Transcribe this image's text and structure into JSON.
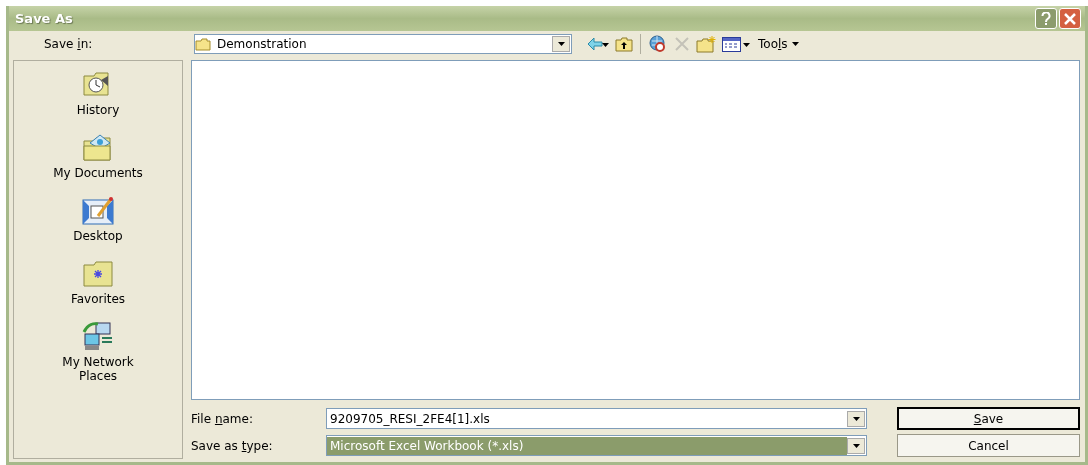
{
  "window": {
    "title": "Save As"
  },
  "save_in": {
    "label": {
      "before": "Save ",
      "key": "i",
      "after": "n:"
    },
    "value": "Demonstration"
  },
  "toolbar": [
    {
      "kind": "back",
      "disabled": false
    },
    {
      "kind": "up",
      "disabled": false
    },
    {
      "kind": "search-web",
      "disabled": false
    },
    {
      "kind": "delete",
      "disabled": true
    },
    {
      "kind": "new-folder",
      "disabled": false
    },
    {
      "kind": "views",
      "disabled": false
    },
    {
      "kind": "tools",
      "disabled": false,
      "label": {
        "before": "Too",
        "key": "l",
        "after": "s"
      }
    }
  ],
  "places": [
    {
      "kind": "history",
      "label": "History",
      "selected": false
    },
    {
      "kind": "documents",
      "label": "My Documents",
      "selected": false
    },
    {
      "kind": "desktop",
      "label": "Desktop",
      "selected": false
    },
    {
      "kind": "favorites",
      "label": "Favorites",
      "selected": false
    },
    {
      "kind": "network",
      "label": "My Network Places",
      "selected": false
    }
  ],
  "file_name": {
    "label": {
      "before": "File ",
      "key": "n",
      "after": "ame:"
    },
    "value": "9209705_RESI_2FE4[1].xls",
    "focused": false
  },
  "save_as_type": {
    "label": {
      "before": "Save as ",
      "key": "t",
      "after": "ype:"
    },
    "value": "Microsoft Excel Workbook (*.xls)",
    "focused": true
  },
  "buttons": [
    {
      "label": {
        "key": "S",
        "after": "ave"
      },
      "default": true
    },
    {
      "label": {
        "before": "Cancel"
      },
      "default": false
    }
  ]
}
